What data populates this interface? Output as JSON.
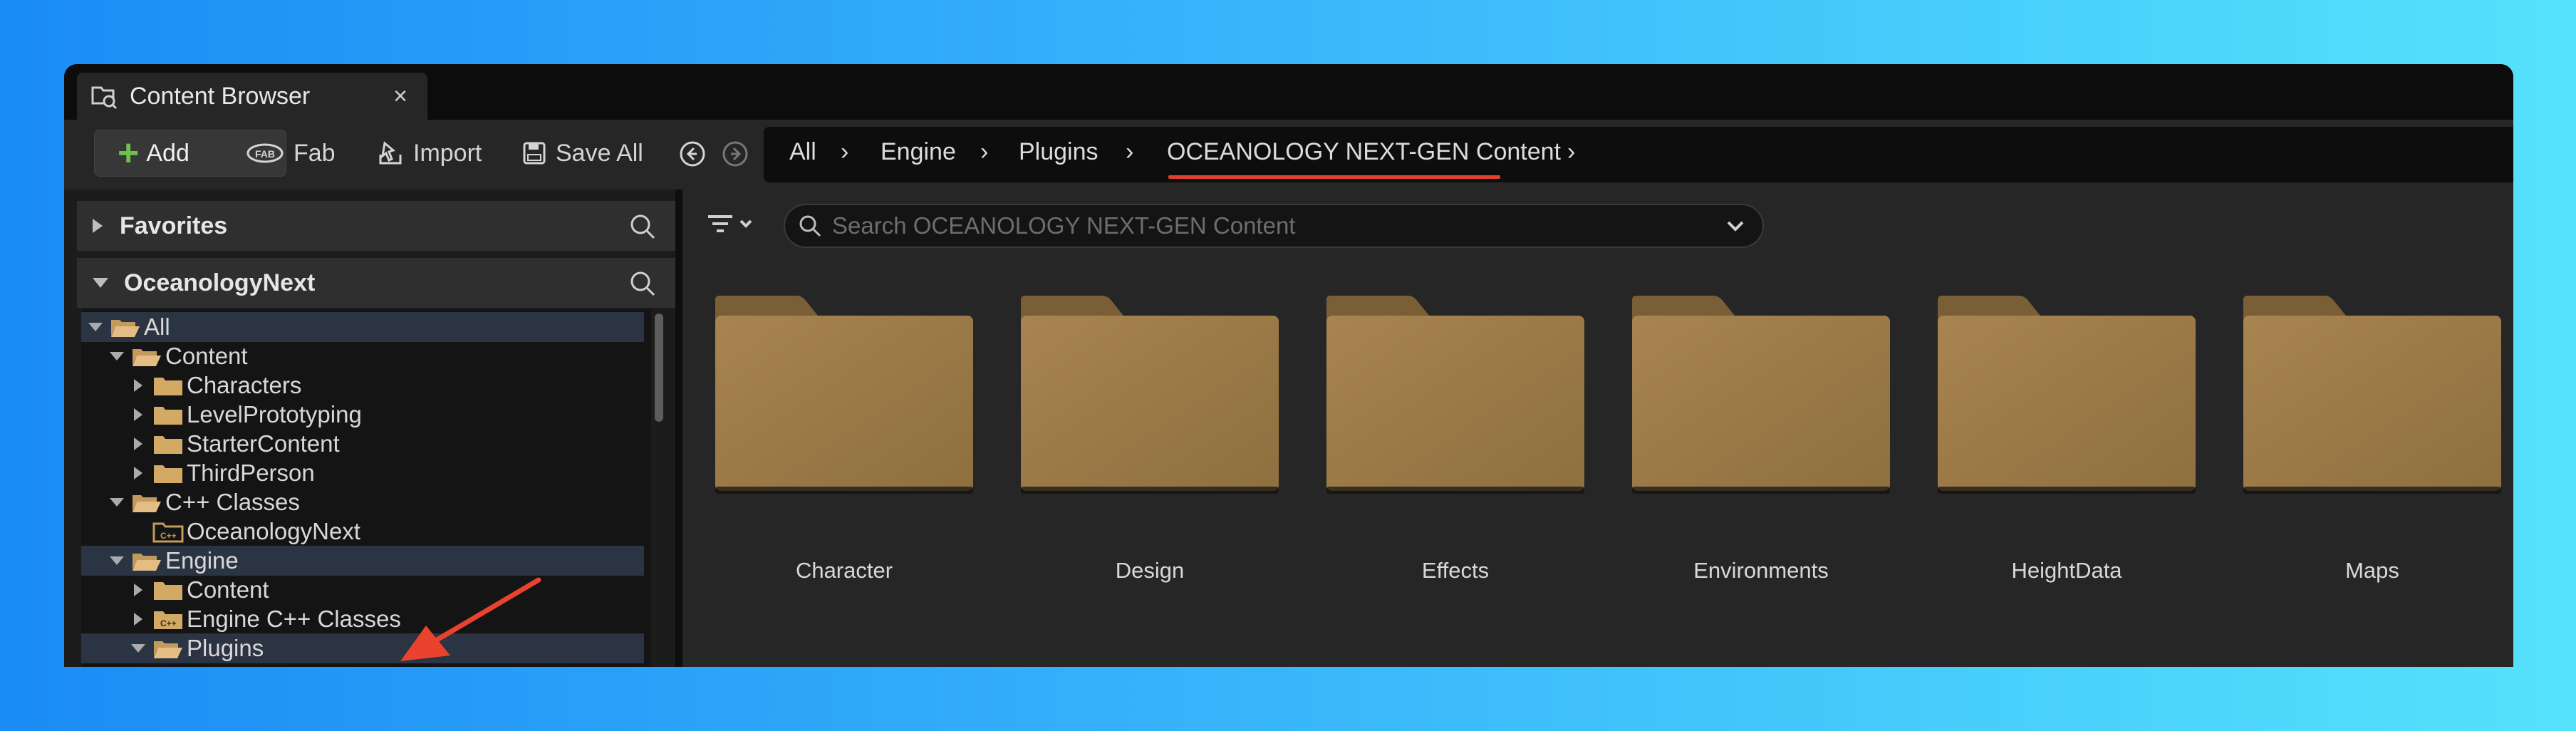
{
  "tab": {
    "title": "Content Browser",
    "close": "×"
  },
  "toolbar": {
    "add": "Add",
    "fab": "Fab",
    "import": "Import",
    "save_all": "Save All"
  },
  "breadcrumb": [
    "All",
    "Engine",
    "Plugins",
    "OCEANOLOGY NEXT-GEN Content"
  ],
  "left_panel": {
    "favorites": "Favorites",
    "project": "OceanologyNext",
    "tree": [
      {
        "label": "All",
        "state": "expanded",
        "selected": true
      },
      {
        "label": "Content",
        "state": "expanded"
      },
      {
        "label": "Characters",
        "state": "collapsed"
      },
      {
        "label": "LevelPrototyping",
        "state": "collapsed"
      },
      {
        "label": "StarterContent",
        "state": "collapsed"
      },
      {
        "label": "ThirdPerson",
        "state": "collapsed"
      },
      {
        "label": "C++ Classes",
        "state": "expanded"
      },
      {
        "label": "OceanologyNext",
        "state": "leaf"
      },
      {
        "label": "Engine",
        "state": "expanded",
        "selected": true
      },
      {
        "label": "Content",
        "state": "collapsed"
      },
      {
        "label": "Engine C++ Classes",
        "state": "collapsed"
      },
      {
        "label": "Plugins",
        "state": "expanded",
        "selected": true
      }
    ]
  },
  "content": {
    "search_placeholder": "Search OCEANOLOGY NEXT-GEN Content",
    "folders": [
      "Character",
      "Design",
      "Effects",
      "Environments",
      "HeightData",
      "Maps"
    ]
  },
  "colors": {
    "folder": "#9c7a45",
    "accent_underline": "#e0402f",
    "add_plus": "#6cc24a",
    "arrow": "#e9432f"
  }
}
